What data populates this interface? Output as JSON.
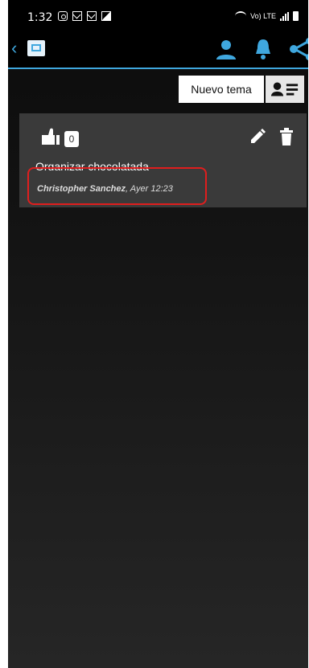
{
  "status_bar": {
    "time": "1:32",
    "network_label": "Vo) LTE"
  },
  "app_bar": {
    "icons": [
      "back-arrow-icon",
      "app-logo",
      "person-icon",
      "bell-icon",
      "share-icon"
    ],
    "accent_color": "#3fa7de"
  },
  "toolbar": {
    "new_topic_label": "Nuevo tema"
  },
  "topic": {
    "likes": "0",
    "title": "Organizar chocolatada",
    "author": "Christopher Sanchez",
    "time_sep": ", ",
    "time": "Ayer 12:23"
  },
  "highlight_color": "#e01e1e"
}
